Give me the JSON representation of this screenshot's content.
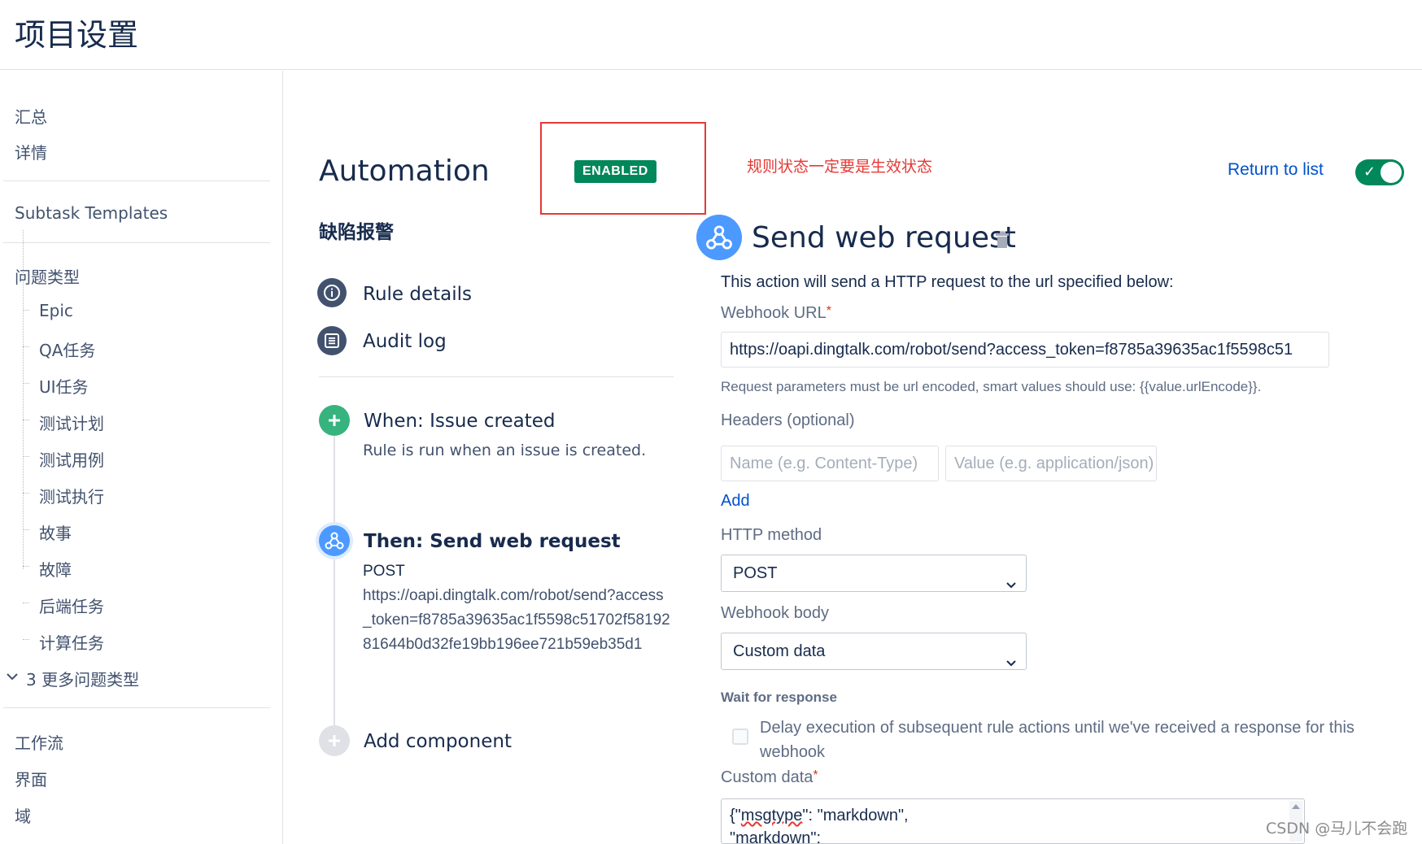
{
  "header": {
    "title": "项目设置"
  },
  "sidebar": {
    "top_items": [
      "汇总",
      "详情"
    ],
    "subtask_templates": "Subtask Templates",
    "issue_types_title": "问题类型",
    "issue_types": [
      "Epic",
      "QA任务",
      "UI任务",
      "测试计划",
      "测试用例",
      "测试执行",
      "故事",
      "故障",
      "后端任务",
      "计算任务"
    ],
    "more_issue_types": "3 更多问题类型",
    "bottom_items": [
      "工作流",
      "界面",
      "域"
    ]
  },
  "automation": {
    "title": "Automation",
    "status_badge": "ENABLED",
    "annotation": "规则状态一定要是生效状态",
    "rule_name": "缺陷报警",
    "nav": {
      "rule_details": "Rule details",
      "audit_log": "Audit log"
    },
    "trigger": {
      "title": "When: Issue created",
      "subtitle": "Rule is run when an issue is created."
    },
    "action": {
      "title": "Then: Send web request",
      "method": "POST",
      "url": "https://oapi.dingtalk.com/robot/send?access_token=f8785a39635ac1f5598c51702f5819281644b0d32fe19bb196ee721b59eb35d1"
    },
    "add_component": "Add component"
  },
  "panel": {
    "return_to_list": "Return to list",
    "toggle_on": true,
    "title": "Send web request",
    "description": "This action will send a HTTP request to the url specified below:",
    "webhook_url_label": "Webhook URL",
    "webhook_url_value": "https://oapi.dingtalk.com/robot/send?access_token=f8785a39635ac1f5598c51",
    "url_help": "Request parameters must be url encoded, smart values should use: {{value.urlEncode}}.",
    "headers_label": "Headers (optional)",
    "header_name_placeholder": "Name (e.g. Content-Type)",
    "header_value_placeholder": "Value (e.g. application/json)",
    "add_label": "Add",
    "http_method_label": "HTTP method",
    "http_method_value": "POST",
    "webhook_body_label": "Webhook body",
    "webhook_body_value": "Custom data",
    "wait_label": "Wait for response",
    "wait_checkbox_label": "Delay execution of subsequent rule actions until we've received a response for this webhook",
    "custom_data_label": "Custom data",
    "custom_data_line1_key": "msgtype",
    "custom_data_line1_rest": "\": \"markdown\",",
    "custom_data_line2": "\"markdown\":"
  },
  "watermark": "CSDN @马儿不会跑",
  "colors": {
    "accent": "#0052cc",
    "enabled": "#00875a",
    "annotation_red": "#e53935",
    "webhook_blue": "#4c9aff"
  }
}
